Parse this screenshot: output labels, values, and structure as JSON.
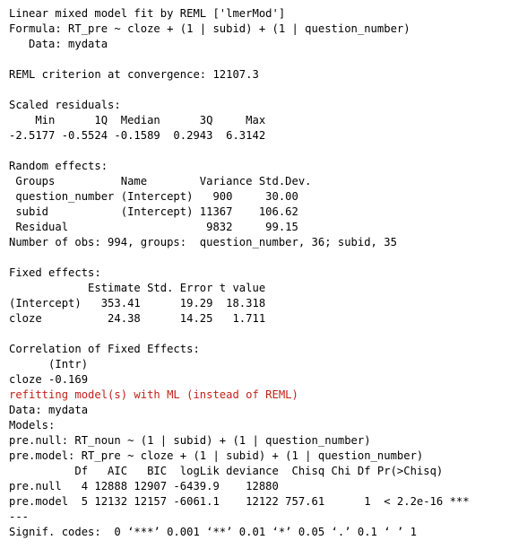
{
  "console": {
    "lines": [
      {
        "text": "Linear mixed model fit by REML ['lmerMod']",
        "type": "output"
      },
      {
        "text": "Formula: RT_pre ~ cloze + (1 | subid) + (1 | question_number)",
        "type": "output"
      },
      {
        "text": "   Data: mydata",
        "type": "output"
      },
      {
        "text": "",
        "type": "output"
      },
      {
        "text": "REML criterion at convergence: 12107.3",
        "type": "output"
      },
      {
        "text": "",
        "type": "output"
      },
      {
        "text": "Scaled residuals:",
        "type": "output"
      },
      {
        "text": "    Min      1Q  Median      3Q     Max",
        "type": "output"
      },
      {
        "text": "-2.5177 -0.5524 -0.1589  0.2943  6.3142",
        "type": "output"
      },
      {
        "text": "",
        "type": "output"
      },
      {
        "text": "Random effects:",
        "type": "output"
      },
      {
        "text": " Groups          Name        Variance Std.Dev.",
        "type": "output"
      },
      {
        "text": " question_number (Intercept)   900     30.00",
        "type": "output"
      },
      {
        "text": " subid           (Intercept) 11367    106.62",
        "type": "output"
      },
      {
        "text": " Residual                     9832     99.15",
        "type": "output"
      },
      {
        "text": "Number of obs: 994, groups:  question_number, 36; subid, 35",
        "type": "output"
      },
      {
        "text": "",
        "type": "output"
      },
      {
        "text": "Fixed effects:",
        "type": "output"
      },
      {
        "text": "            Estimate Std. Error t value",
        "type": "output"
      },
      {
        "text": "(Intercept)   353.41      19.29  18.318",
        "type": "output"
      },
      {
        "text": "cloze          24.38      14.25   1.711",
        "type": "output"
      },
      {
        "text": "",
        "type": "output"
      },
      {
        "text": "Correlation of Fixed Effects:",
        "type": "output"
      },
      {
        "text": "      (Intr)",
        "type": "output"
      },
      {
        "text": "cloze -0.169",
        "type": "output"
      },
      {
        "text": "refitting model(s) with ML (instead of REML)",
        "type": "message"
      },
      {
        "text": "Data: mydata",
        "type": "output"
      },
      {
        "text": "Models:",
        "type": "output"
      },
      {
        "text": "pre.null: RT_noun ~ (1 | subid) + (1 | question_number)",
        "type": "output"
      },
      {
        "text": "pre.model: RT_pre ~ cloze + (1 | subid) + (1 | question_number)",
        "type": "output"
      },
      {
        "text": "          Df   AIC   BIC  logLik deviance  Chisq Chi Df Pr(>Chisq)",
        "type": "output"
      },
      {
        "text": "pre.null   4 12888 12907 -6439.9    12880",
        "type": "output"
      },
      {
        "text": "pre.model  5 12132 12157 -6061.1    12122 757.61      1  < 2.2e-16 ***",
        "type": "output"
      },
      {
        "text": "---",
        "type": "output"
      },
      {
        "text": "Signif. codes:  0 ‘***’ 0.001 ‘**’ 0.01 ‘*’ 0.05 ‘.’ 0.1 ‘ ’ 1",
        "type": "output"
      }
    ],
    "colors": {
      "text": "#000000",
      "message": "#c0221a",
      "background": "#ffffff"
    }
  }
}
